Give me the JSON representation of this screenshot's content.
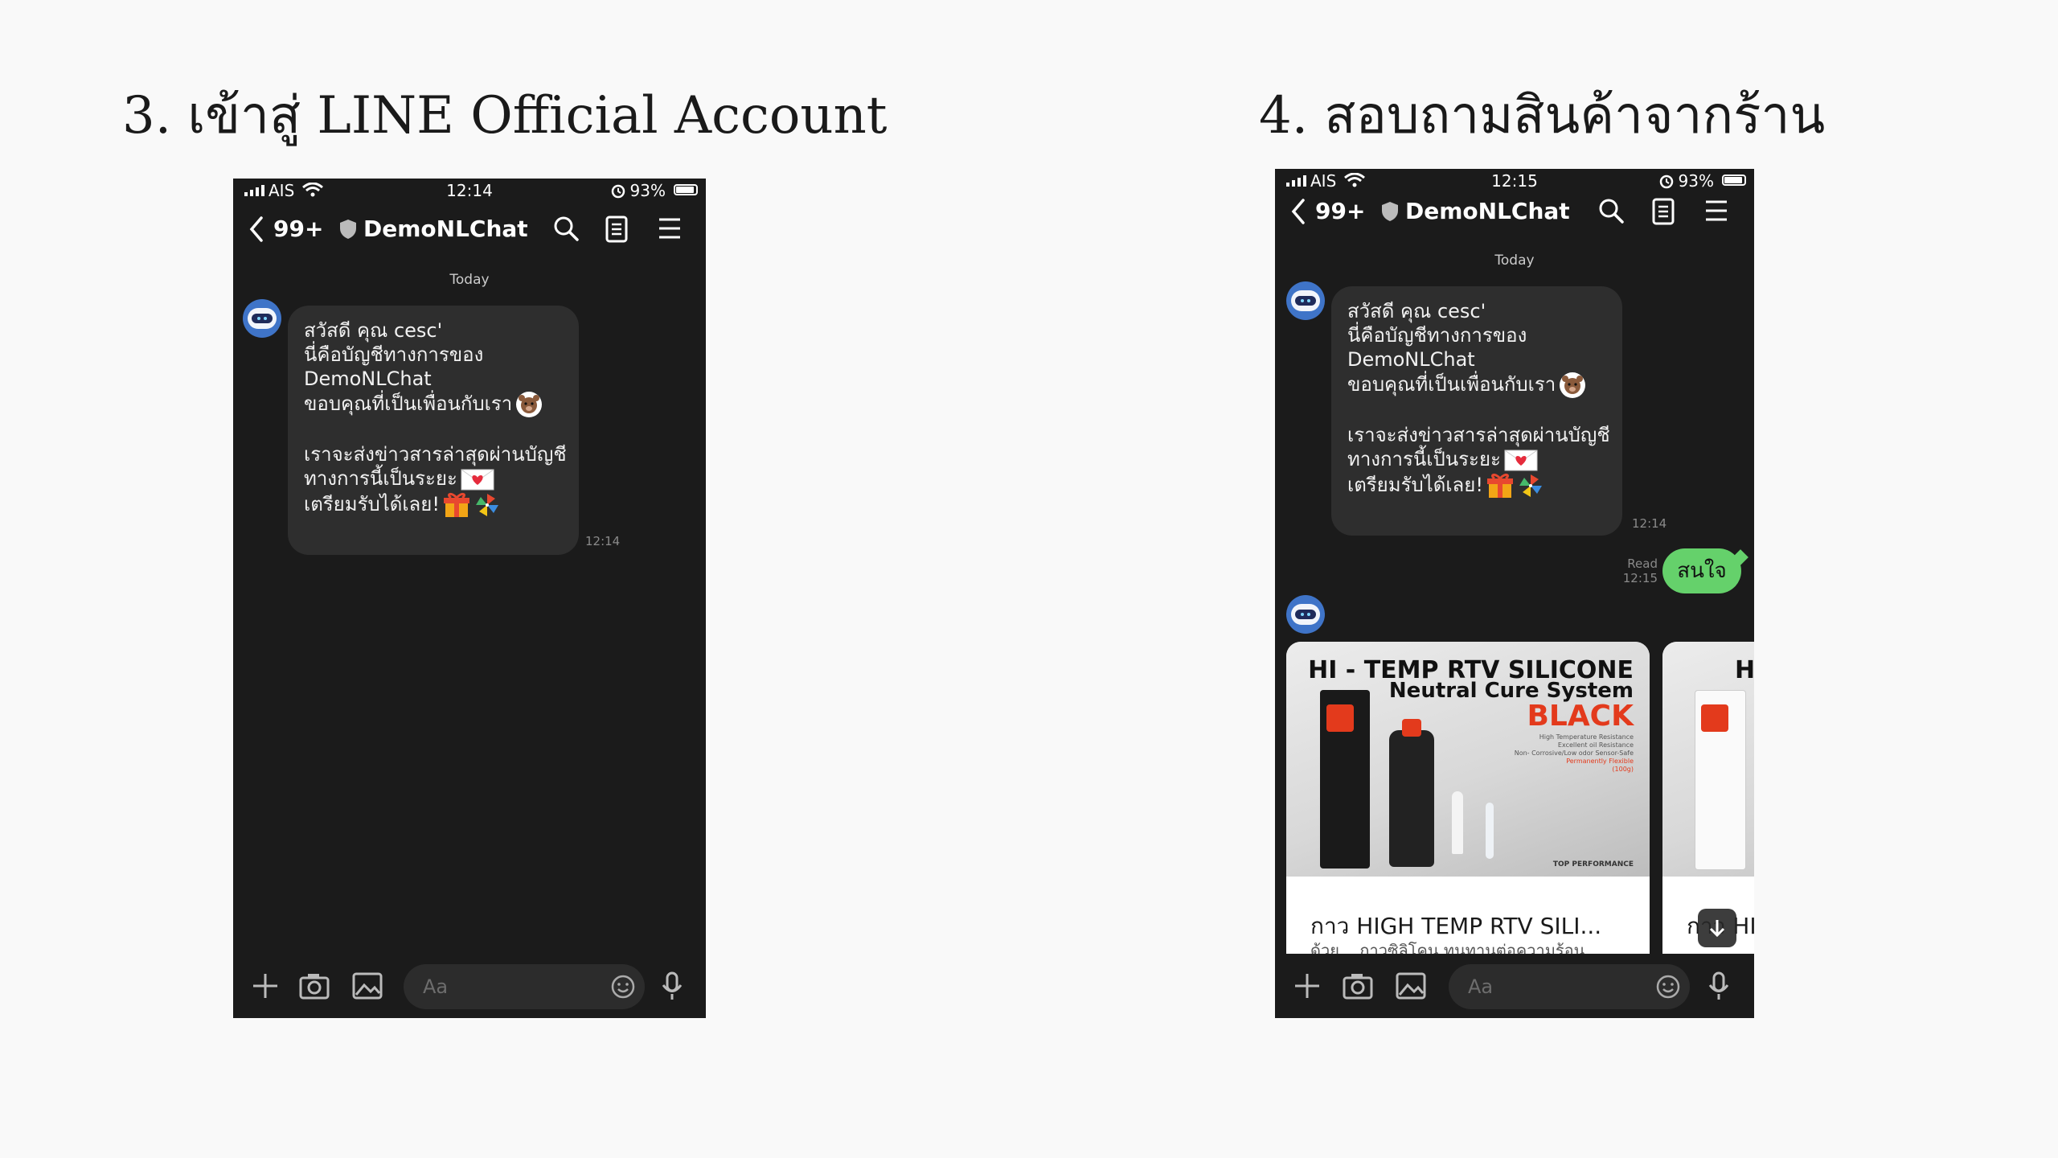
{
  "steps": [
    {
      "heading": "3. เข้าสู่ LINE Official Account"
    },
    {
      "heading": "4. สอบถามสินค้าจากร้าน"
    }
  ],
  "phone_left": {
    "status": {
      "carrier": "AIS",
      "time": "12:14",
      "battery": "93%"
    },
    "nav": {
      "back_count": "99+",
      "title": "DemoNLChat"
    },
    "chat": {
      "date_label": "Today",
      "message": {
        "lines": [
          "สวัสดี คุณ cesc'",
          "นี่คือบัญชีทางการของ",
          "DemoNLChat",
          "ขอบคุณที่เป็นเพื่อนกับเรา",
          "",
          "เราจะส่งข่าวสารล่าสุดผ่านบัญชี",
          "ทางการนี้เป็นระยะ",
          "เตรียมรับได้เลย!"
        ],
        "time": "12:14"
      }
    },
    "input": {
      "placeholder": "Aa"
    }
  },
  "phone_right": {
    "status": {
      "carrier": "AIS",
      "time": "12:15",
      "battery": "93%"
    },
    "nav": {
      "back_count": "99+",
      "title": "DemoNLChat"
    },
    "chat": {
      "date_label": "Today",
      "message": {
        "lines": [
          "สวัสดี คุณ cesc'",
          "นี่คือบัญชีทางการของ",
          "DemoNLChat",
          "ขอบคุณที่เป็นเพื่อนกับเรา",
          "",
          "เราจะส่งข่าวสารล่าสุดผ่านบัญชี",
          "ทางการนี้เป็นระยะ",
          "เตรียมรับได้เลย!"
        ],
        "time": "12:14"
      },
      "reply": {
        "text": "สนใจ",
        "read_label": "Read",
        "read_time": "12:15"
      },
      "cards": [
        {
          "img_title": "HI - TEMP RTV SILICONE",
          "img_subtitle": "Neutral Cure System",
          "img_color": "BLACK",
          "img_fine": [
            "High Temperature Resistance",
            "Excellent oil Resistance",
            "Non- Corrosive/Low odor Sensor-Safe",
            "Permanently Flexible",
            "(100g)"
          ],
          "img_footer": "TOP PERFORMANCE",
          "title": "กาว HIGH TEMP RTV SILI...",
          "subtitle": "ด้วย... กาวซิลิโคน ทนทานต่อความร้อน"
        },
        {
          "img_title": "HI",
          "title": "กาว HI"
        }
      ]
    },
    "input": {
      "placeholder": "Aa"
    }
  },
  "colors": {
    "page_bg": "#f9f9f9",
    "chat_bg": "#1b1b1b",
    "bubble": "#2e2e2e",
    "user_bubble": "#65d16b",
    "accent_red": "#e33a1c"
  }
}
